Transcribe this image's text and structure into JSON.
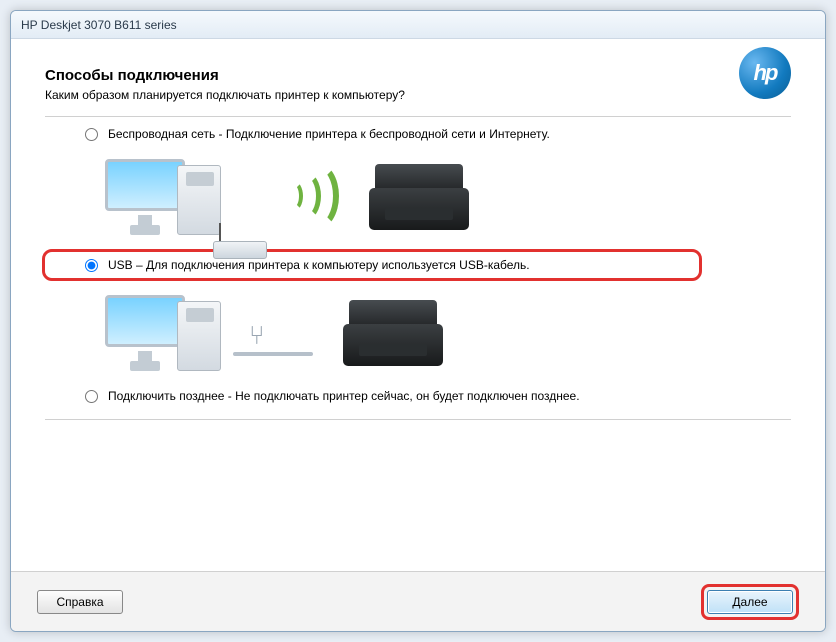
{
  "window": {
    "title": "HP Deskjet 3070 B611 series"
  },
  "page": {
    "heading": "Способы подключения",
    "subheading": "Каким образом планируется подключать принтер к компьютеру?"
  },
  "options": {
    "wireless": {
      "label": "Беспроводная сеть - Подключение принтера к беспроводной сети и Интернету.",
      "checked": false
    },
    "usb": {
      "label": "USB – Для подключения принтера к компьютеру используется USB-кабель.",
      "checked": true
    },
    "later": {
      "label": "Подключить позднее - Не подключать принтер сейчас, он будет подключен  позднее.",
      "checked": false
    }
  },
  "buttons": {
    "help": "Справка",
    "next": "Далее"
  },
  "logo": {
    "text": "hp"
  }
}
